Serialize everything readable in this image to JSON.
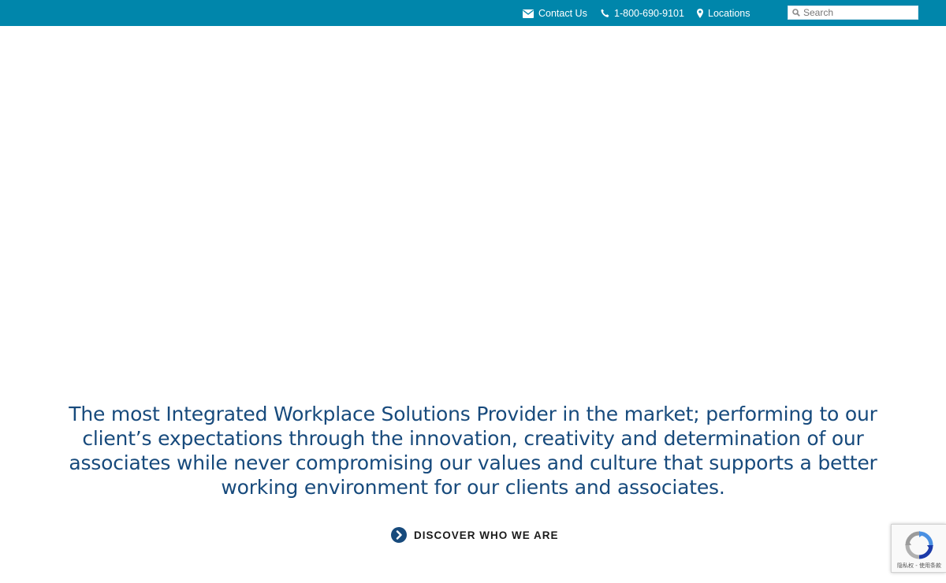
{
  "colors": {
    "topbar_bg": "#0086ab",
    "mission_text": "#174a7c",
    "accent_icon": "#174a7c"
  },
  "header": {
    "contact": {
      "label": "Contact Us",
      "icon": "envelope-icon"
    },
    "phone": {
      "label": "1-800-690-9101",
      "icon": "phone-icon"
    },
    "locations": {
      "label": "Locations",
      "icon": "map-pin-icon"
    },
    "search": {
      "placeholder": "Search",
      "value": "",
      "icon": "search-icon"
    }
  },
  "hero": {
    "mission": "The most Integrated Workplace Solutions Provider in the market; performing to our client’s expectations through the innovation, creativity and determination of our associates while never compromising our values and culture that supports a better working environment for our clients and associates.",
    "cta_label": "DISCOVER WHO WE ARE",
    "cta_icon": "chevron-right-circle-icon"
  },
  "recaptcha": {
    "terms": "隐私权 - 使用条款",
    "icon": "recaptcha-icon"
  }
}
